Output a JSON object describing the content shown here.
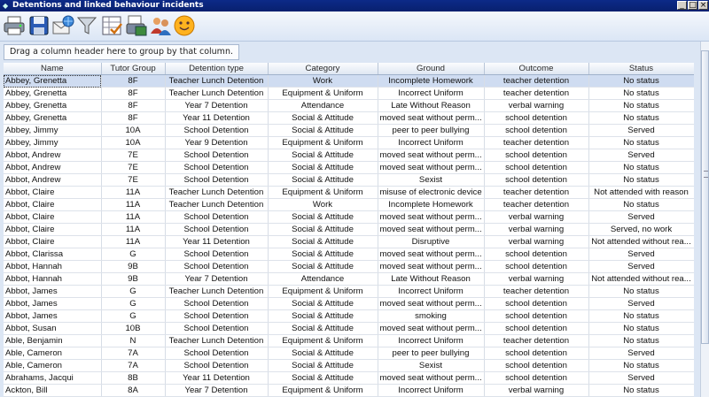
{
  "window": {
    "title": "Detentions and linked behaviour incidents"
  },
  "toolbar": {
    "buttons": [
      {
        "name": "print-icon"
      },
      {
        "name": "save-icon"
      },
      {
        "name": "email-icon"
      },
      {
        "name": "filter-icon"
      },
      {
        "name": "choose-columns-icon"
      },
      {
        "name": "export-icon"
      },
      {
        "name": "people-icon"
      },
      {
        "name": "smiley-icon"
      }
    ]
  },
  "group_panel": {
    "hint": "Drag a column header here to group by that column."
  },
  "columns": [
    "Name",
    "Tutor Group",
    "Detention type",
    "Category",
    "Ground",
    "Outcome",
    "Status"
  ],
  "rows": [
    [
      "Abbey, Grenetta",
      "8F",
      "Teacher Lunch Detention",
      "Work",
      "Incomplete Homework",
      "teacher detention",
      "No status"
    ],
    [
      "Abbey, Grenetta",
      "8F",
      "Teacher Lunch Detention",
      "Equipment & Uniform",
      "Incorrect Uniform",
      "teacher detention",
      "No status"
    ],
    [
      "Abbey, Grenetta",
      "8F",
      "Year 7 Detention",
      "Attendance",
      "Late Without Reason",
      "verbal warning",
      "No status"
    ],
    [
      "Abbey, Grenetta",
      "8F",
      "Year 11 Detention",
      "Social & Attitude",
      "moved seat without perm...",
      "school detention",
      "No status"
    ],
    [
      "Abbey, Jimmy",
      "10A",
      "School Detention",
      "Social & Attitude",
      "peer to peer bullying",
      "school detention",
      "Served"
    ],
    [
      "Abbey, Jimmy",
      "10A",
      "Year 9 Detention",
      "Equipment & Uniform",
      "Incorrect Uniform",
      "teacher detention",
      "No status"
    ],
    [
      "Abbot, Andrew",
      "7E",
      "School Detention",
      "Social & Attitude",
      "moved seat without perm...",
      "school detention",
      "Served"
    ],
    [
      "Abbot, Andrew",
      "7E",
      "School Detention",
      "Social & Attitude",
      "moved seat without perm...",
      "school detention",
      "No status"
    ],
    [
      "Abbot, Andrew",
      "7E",
      "School Detention",
      "Social & Attitude",
      "Sexist",
      "school detention",
      "No status"
    ],
    [
      "Abbot, Claire",
      "11A",
      "Teacher Lunch Detention",
      "Equipment & Uniform",
      "misuse of electronic device",
      "teacher detention",
      "Not attended with reason"
    ],
    [
      "Abbot, Claire",
      "11A",
      "Teacher Lunch Detention",
      "Work",
      "Incomplete Homework",
      "teacher detention",
      "No status"
    ],
    [
      "Abbot, Claire",
      "11A",
      "School Detention",
      "Social & Attitude",
      "moved seat without perm...",
      "verbal warning",
      "Served"
    ],
    [
      "Abbot, Claire",
      "11A",
      "School Detention",
      "Social & Attitude",
      "moved seat without perm...",
      "verbal warning",
      "Served, no work"
    ],
    [
      "Abbot, Claire",
      "11A",
      "Year 11 Detention",
      "Social & Attitude",
      "Disruptive",
      "verbal warning",
      "Not attended without rea..."
    ],
    [
      "Abbot, Clarissa",
      "G",
      "School Detention",
      "Social & Attitude",
      "moved seat without perm...",
      "school detention",
      "Served"
    ],
    [
      "Abbot, Hannah",
      "9B",
      "School Detention",
      "Social & Attitude",
      "moved seat without perm...",
      "school detention",
      "Served"
    ],
    [
      "Abbot, Hannah",
      "9B",
      "Year 7 Detention",
      "Attendance",
      "Late Without Reason",
      "verbal warning",
      "Not attended without rea..."
    ],
    [
      "Abbot, James",
      "G",
      "Teacher Lunch Detention",
      "Equipment & Uniform",
      "Incorrect Uniform",
      "teacher detention",
      "No status"
    ],
    [
      "Abbot, James",
      "G",
      "School Detention",
      "Social & Attitude",
      "moved seat without perm...",
      "school detention",
      "Served"
    ],
    [
      "Abbot, James",
      "G",
      "School Detention",
      "Social & Attitude",
      "smoking",
      "school detention",
      "No status"
    ],
    [
      "Abbot, Susan",
      "10B",
      "School Detention",
      "Social & Attitude",
      "moved seat without perm...",
      "school detention",
      "No status"
    ],
    [
      "Able, Benjamin",
      "N",
      "Teacher Lunch Detention",
      "Equipment & Uniform",
      "Incorrect Uniform",
      "teacher detention",
      "No status"
    ],
    [
      "Able, Cameron",
      "7A",
      "School Detention",
      "Social & Attitude",
      "peer to peer bullying",
      "school detention",
      "Served"
    ],
    [
      "Able, Cameron",
      "7A",
      "School Detention",
      "Social & Attitude",
      "Sexist",
      "school detention",
      "No status"
    ],
    [
      "Abrahams, Jacqui",
      "8B",
      "Year 11 Detention",
      "Social & Attitude",
      "moved seat without perm...",
      "school detention",
      "Served"
    ],
    [
      "Ackton, Bill",
      "8A",
      "Year 7 Detention",
      "Equipment & Uniform",
      "Incorrect Uniform",
      "verbal warning",
      "No status"
    ]
  ],
  "selected_row": 0
}
